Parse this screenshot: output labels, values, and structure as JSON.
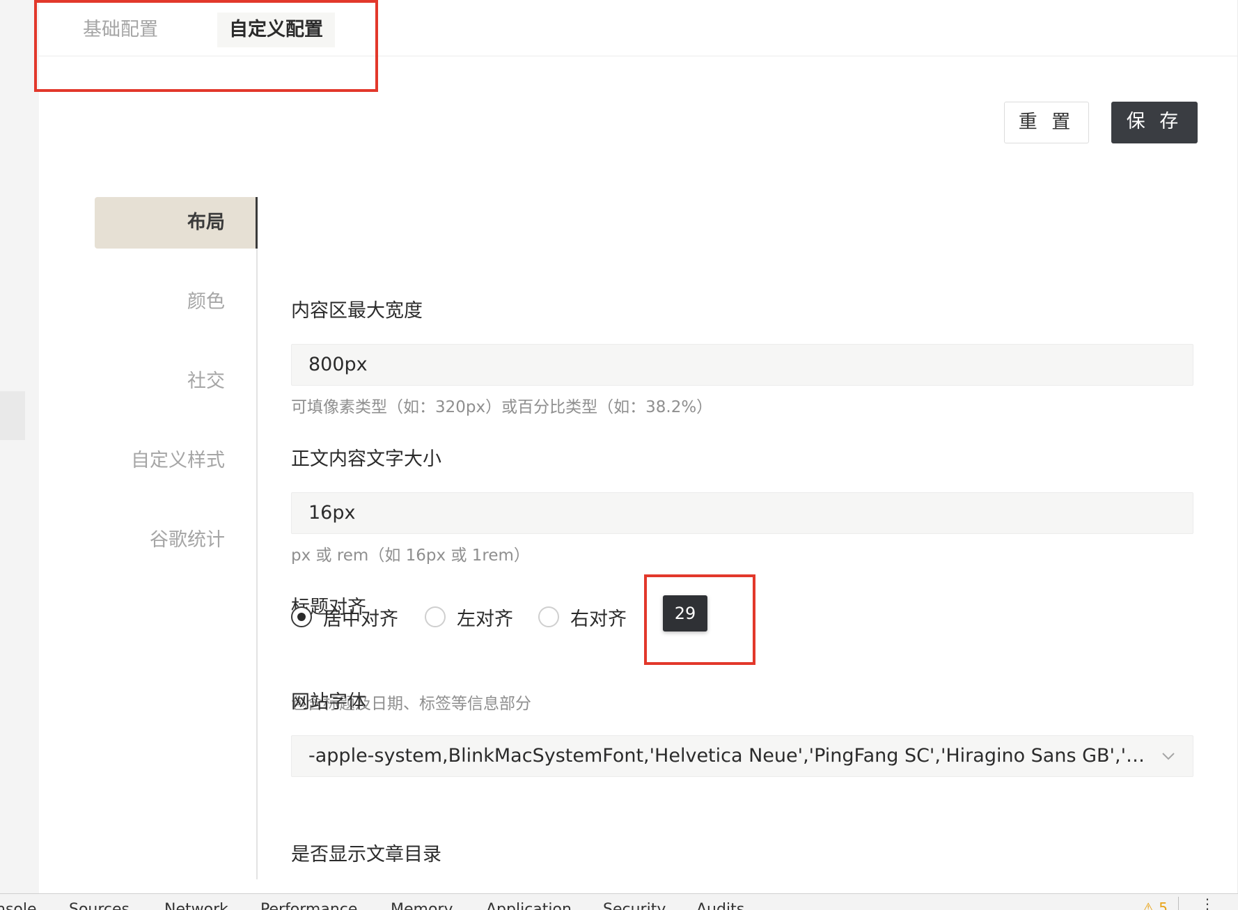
{
  "top_tabs": [
    "基础配置",
    "自定义配置"
  ],
  "buttons": {
    "reset": "重 置",
    "save": "保 存"
  },
  "side_nav": [
    "布局",
    "颜色",
    "社交",
    "自定义样式",
    "谷歌统计"
  ],
  "fields": {
    "max_width": {
      "label": "内容区最大宽度",
      "value": "800px",
      "hint": "可填像素类型（如：320px）或百分比类型（如：38.2%）"
    },
    "font_size": {
      "label": "正文内容文字大小",
      "value": "16px",
      "hint": "px 或 rem（如 16px 或 1rem）"
    },
    "title_align": {
      "label": "标题对齐",
      "options": [
        "居中对齐",
        "左对齐",
        "右对齐"
      ],
      "selected": "居中对齐",
      "hint": "包含标题及日期、标签等信息部分"
    },
    "site_font": {
      "label": "网站字体",
      "value": "-apple-system,BlinkMacSystemFont,'Helvetica Neue','PingFang SC','Hiragino Sans GB','Droid..."
    },
    "show_toc": {
      "label": "是否显示文章目录"
    }
  },
  "tooltip": "29",
  "devtools_tabs": [
    "nsole",
    "Sources",
    "Network",
    "Performance",
    "Memory",
    "Application",
    "Security",
    "Audits"
  ],
  "devtools_warning": "⚠ 5",
  "devtools_more": "⋮",
  "colors": {
    "accent_dark": "#3a3d42",
    "nav_active_bg": "#e6e0d4",
    "annotation_red": "#e2382b"
  }
}
